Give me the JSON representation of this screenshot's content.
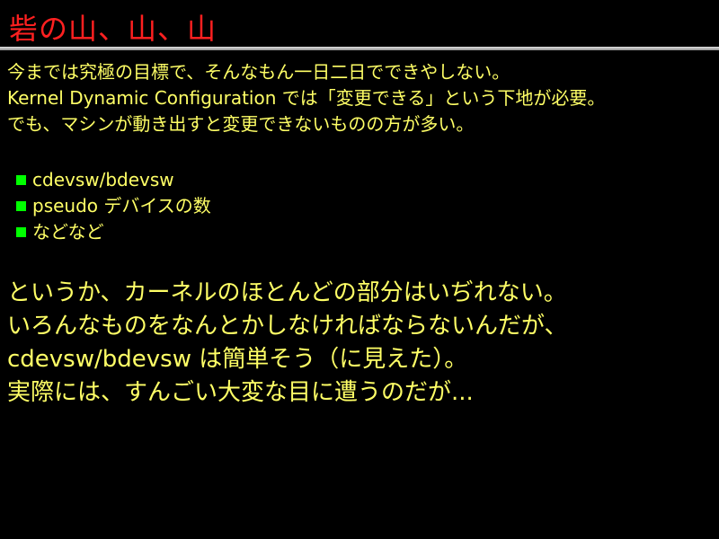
{
  "slide": {
    "title": "砦の山、山、山",
    "colors": {
      "background": "#000000",
      "title": "#ff2020",
      "text": "#ffff66",
      "bullet": "#00ff00",
      "rule": "#c0c0c0"
    },
    "intro_lines": [
      "今までは究極の目標で、そんなもん一日二日でできやしない。",
      "Kernel Dynamic Configuration では「変更できる」という下地が必要。",
      "でも、マシンが動き出すと変更できないものの方が多い。"
    ],
    "bullets": [
      {
        "icon": "green-square-bullet-icon",
        "text": "cdevsw/bdevsw"
      },
      {
        "icon": "green-square-bullet-icon",
        "text": "pseudo デバイスの数"
      },
      {
        "icon": "green-square-bullet-icon",
        "text": "などなど"
      }
    ],
    "conclusion_lines": [
      "というか、カーネルのほとんどの部分はいぢれない。",
      "いろんなものをなんとかしなければならないんだが、",
      "cdevsw/bdevsw は簡単そう（に見えた）。",
      "実際には、すんごい大変な目に遭うのだが..."
    ]
  }
}
